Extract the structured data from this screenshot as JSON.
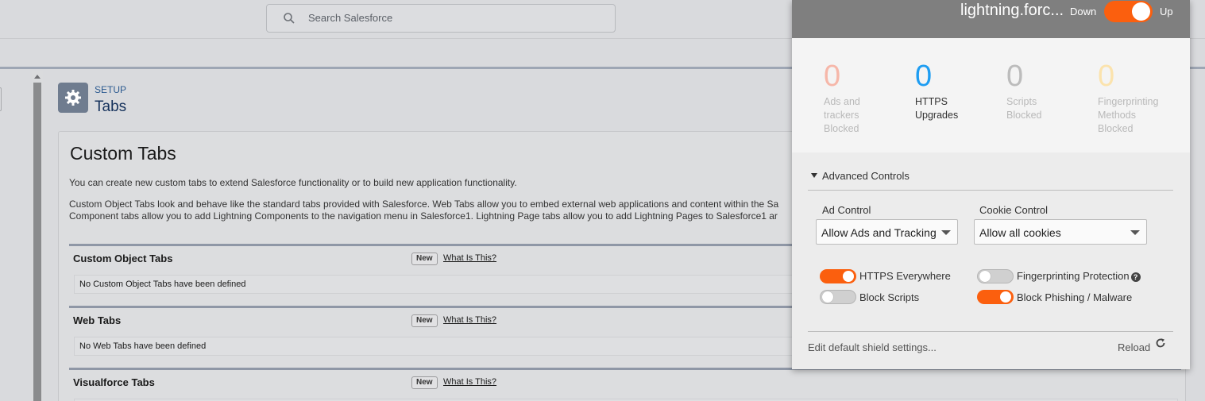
{
  "search": {
    "placeholder": "Search Salesforce"
  },
  "setup": {
    "eyebrow": "SETUP",
    "title": "Tabs"
  },
  "panel": {
    "title": "Custom Tabs",
    "intro": "You can create new custom tabs to extend Salesforce functionality or to build new application functionality.",
    "desc_line1": "Custom Object Tabs look and behave like the standard tabs provided with Salesforce. Web Tabs allow you to embed external web applications and content within the Sa",
    "desc_line2": "Component tabs allow you to add Lightning Components to the navigation menu in Salesforce1. Lightning Page tabs allow you to add Lightning Pages to Salesforce1 ar"
  },
  "sections": [
    {
      "title": "Custom Object Tabs",
      "new_label": "New",
      "help_link": "What Is This?",
      "empty_text": "No Custom Object Tabs have been defined"
    },
    {
      "title": "Web Tabs",
      "new_label": "New",
      "help_link": "What Is This?",
      "empty_text": "No Web Tabs have been defined"
    },
    {
      "title": "Visualforce Tabs",
      "new_label": "New",
      "help_link": "What Is This?",
      "empty_text": ""
    }
  ],
  "shields": {
    "host": "lightning.forc...",
    "down_label": "Down",
    "up_label": "Up",
    "shields_up": true,
    "stats": [
      {
        "value": "0",
        "label_lines": [
          "Ads and",
          "trackers",
          "Blocked"
        ],
        "color": "#f6b7a9"
      },
      {
        "value": "0",
        "label_lines": [
          "HTTPS",
          "Upgrades"
        ],
        "color": "#1e9df2"
      },
      {
        "value": "0",
        "label_lines": [
          "Scripts",
          "Blocked"
        ],
        "color": "#bcbcbc"
      },
      {
        "value": "0",
        "label_lines": [
          "Fingerprinting",
          "Methods",
          "Blocked"
        ],
        "color": "#fbe3ad"
      }
    ],
    "advanced_title": "Advanced Controls",
    "ad_control": {
      "label": "Ad Control",
      "value": "Allow Ads and Tracking"
    },
    "cookie_control": {
      "label": "Cookie Control",
      "value": "Allow all cookies"
    },
    "toggles": {
      "https_everywhere": {
        "label": "HTTPS Everywhere",
        "on": true
      },
      "block_scripts": {
        "label": "Block Scripts",
        "on": false
      },
      "fingerprinting": {
        "label": "Fingerprinting Protection",
        "on": false
      },
      "block_phishing": {
        "label": "Block Phishing / Malware",
        "on": true
      }
    },
    "footer": {
      "edit_link": "Edit default shield settings...",
      "reload_label": "Reload"
    },
    "accent_color": "#fb5f0e",
    "header_color": "#7f7f7f"
  }
}
